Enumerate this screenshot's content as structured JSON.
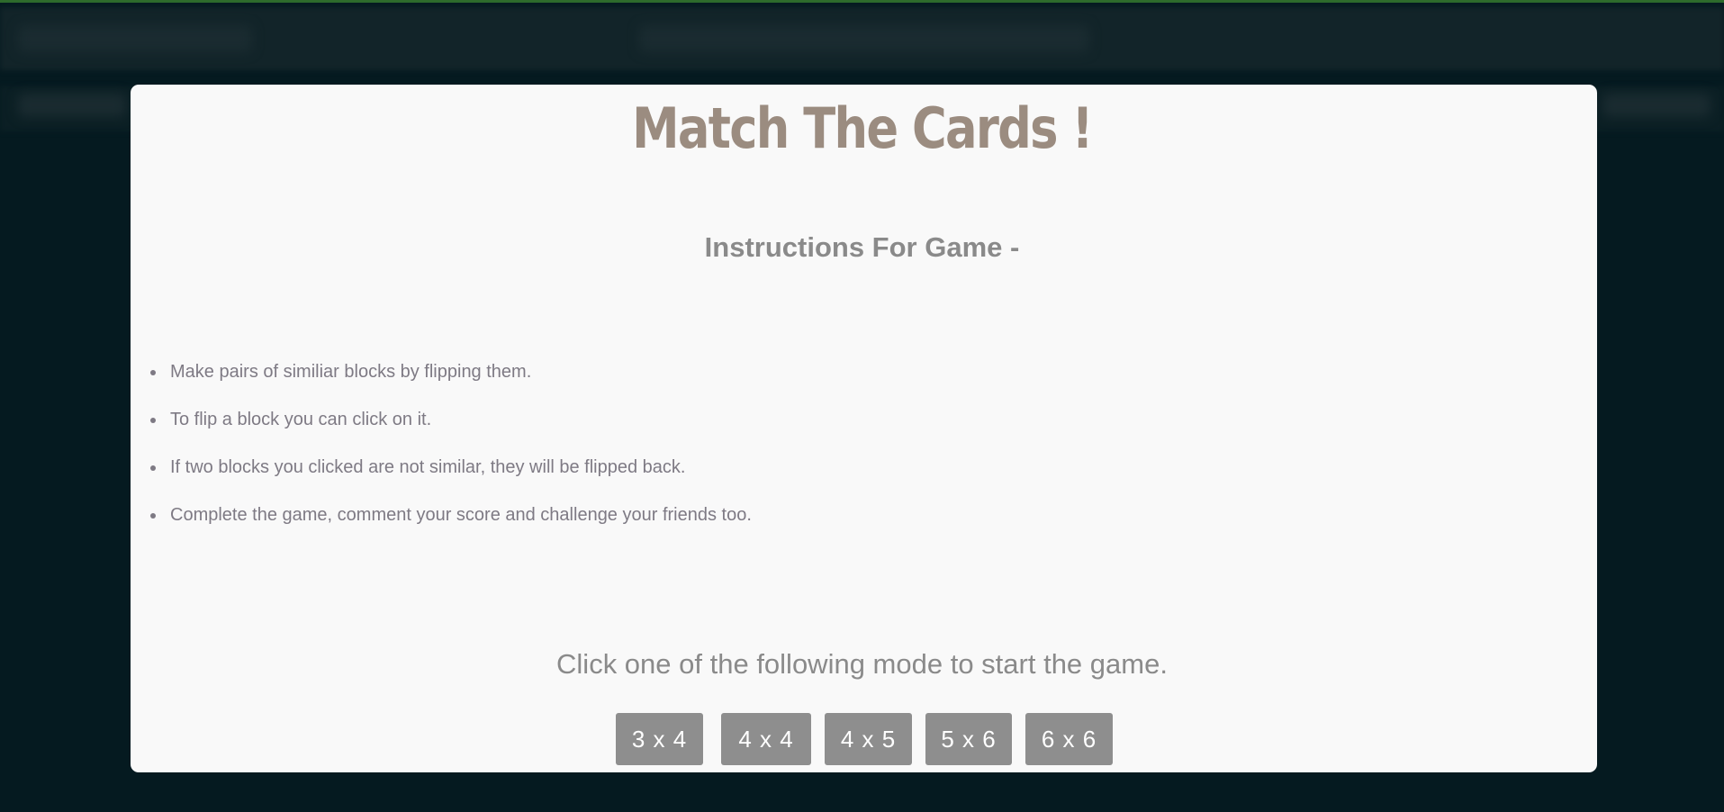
{
  "game": {
    "title": "Match The Cards !",
    "instructions_heading": "Instructions For Game -",
    "instructions": [
      "Make pairs of similiar blocks by flipping them.",
      "To flip a block you can click on it.",
      "If two blocks you clicked are not similar, they will be flipped back.",
      "Complete the game, comment your score and challenge your friends too."
    ],
    "mode_prompt": "Click one of the following mode to start the game.",
    "modes": [
      "3 x 4",
      "4 x 4",
      "4 x 5",
      "5 x 6",
      "6 x 6"
    ]
  },
  "colors": {
    "background": "#051a20",
    "accent_line": "#2e6b2c",
    "modal": "#f9f9f9",
    "title": "#9b8c80",
    "button": "#8e8e8e"
  }
}
